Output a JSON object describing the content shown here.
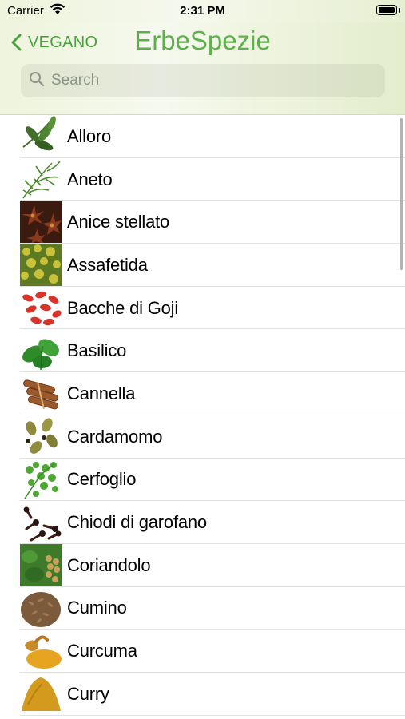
{
  "status_bar": {
    "carrier": "Carrier",
    "time": "2:31 PM",
    "wifi_icon": "wifi-icon",
    "battery_icon": "battery-icon"
  },
  "nav": {
    "back_label": "VEGANO",
    "title": "ErbeSpezie",
    "accent_color": "#5cb14a"
  },
  "search": {
    "placeholder": "Search",
    "value": ""
  },
  "items": [
    {
      "name": "Alloro",
      "thumb": "bay-leaf-image"
    },
    {
      "name": "Aneto",
      "thumb": "dill-image"
    },
    {
      "name": "Anice stellato",
      "thumb": "star-anise-image"
    },
    {
      "name": "Assafetida",
      "thumb": "asafoetida-image"
    },
    {
      "name": "Bacche di Goji",
      "thumb": "goji-berries-image"
    },
    {
      "name": "Basilico",
      "thumb": "basil-image"
    },
    {
      "name": "Cannella",
      "thumb": "cinnamon-image"
    },
    {
      "name": "Cardamomo",
      "thumb": "cardamom-image"
    },
    {
      "name": "Cerfoglio",
      "thumb": "chervil-image"
    },
    {
      "name": "Chiodi di garofano",
      "thumb": "cloves-image"
    },
    {
      "name": "Coriandolo",
      "thumb": "coriander-image"
    },
    {
      "name": "Cumino",
      "thumb": "cumin-image"
    },
    {
      "name": "Curcuma",
      "thumb": "turmeric-image"
    },
    {
      "name": "Curry",
      "thumb": "curry-image"
    }
  ]
}
